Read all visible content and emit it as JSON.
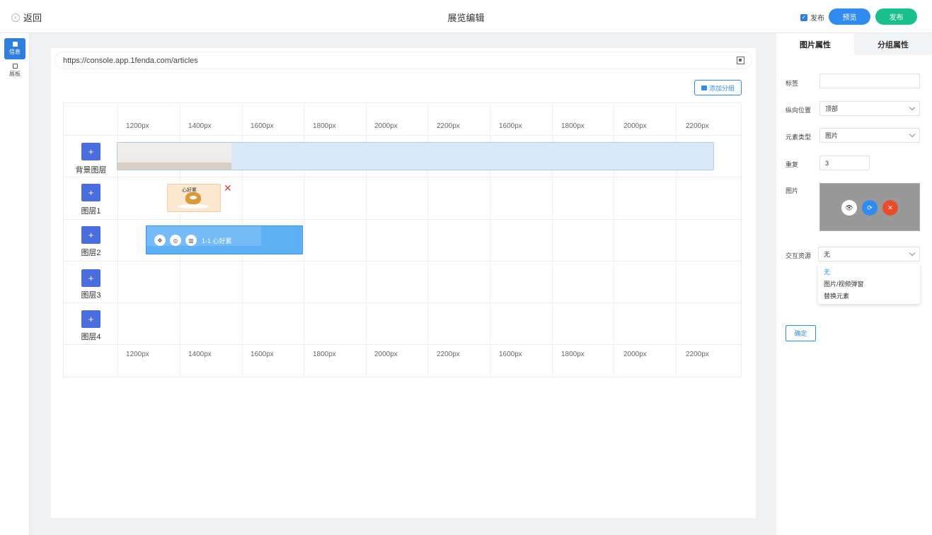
{
  "header": {
    "back_label": "返回",
    "title": "展览编辑",
    "publish_check_label": "发布",
    "preview_label": "预览",
    "publish_label": "发布"
  },
  "rail": {
    "items": [
      {
        "label": "信息",
        "icon": "doc-icon",
        "active": true
      },
      {
        "label": "展板",
        "icon": "board-icon",
        "active": false
      }
    ]
  },
  "canvas": {
    "url": "https://console.app.1fenda.com/articles",
    "add_group_label": "添加分组",
    "columns": [
      "1200px",
      "1400px",
      "1600px",
      "1800px",
      "2000px",
      "2200px",
      "1600px",
      "1800px",
      "2000px",
      "2200px"
    ],
    "layers": [
      {
        "add": "+",
        "label": "背景图层"
      },
      {
        "add": "+",
        "label": "图层1"
      },
      {
        "add": "+",
        "label": "图层2"
      },
      {
        "add": "+",
        "label": "图层3"
      },
      {
        "add": "+",
        "label": "图层4"
      }
    ],
    "layer1_close": "✕",
    "layer1_thumb_text": "心好累",
    "layer2_block_label": "1-1 心好累"
  },
  "panel": {
    "tabs": [
      "图片属性",
      "分组属性"
    ],
    "tag_label": "标签",
    "tag_value": "",
    "vpos_label": "纵向位置",
    "vpos_value": "顶部",
    "type_label": "元素类型",
    "type_value": "图片",
    "repeat_label": "重复",
    "repeat_value": "3",
    "image_label": "图片",
    "interact_label": "交互资源",
    "interact_value": "无",
    "interact_options": [
      "无",
      "图片/视频弹窗",
      "替换元素"
    ],
    "confirm_label": "确定"
  },
  "colors": {
    "primary": "#2f8bf0",
    "success": "#18c08c",
    "danger": "#e53935",
    "layer_button": "#4a6ee0"
  }
}
